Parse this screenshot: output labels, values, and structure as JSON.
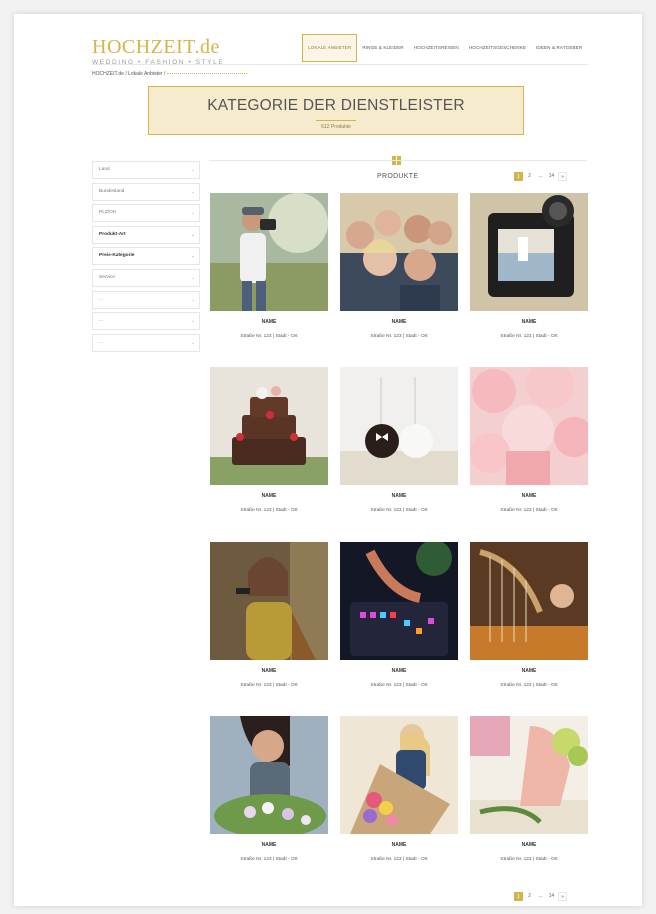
{
  "header": {
    "logo_main": "HOCHZEIT.de",
    "logo_sub": "WEDDING  •  FASHION  •  STYLE",
    "nav": [
      "LOKALE ANBIETER",
      "RINGE & KLEIDER",
      "HOCHZEITSREISEN",
      "HOCHZEITSGESCHENKE",
      "IDEEN & RATGEBER"
    ]
  },
  "breadcrumb": "HOCHZEIT.de / Lokale Anbieter /",
  "hero": {
    "title": "KATEGORIE DER DIENSTLEISTER",
    "count": "612 Produkte"
  },
  "filters": [
    "Land",
    "Bundesland",
    "PLZ/Ort",
    "Produkt-Art",
    "Preis-Kategorie",
    "Service",
    "...",
    "...",
    "..."
  ],
  "products_label": "PRODUKTE",
  "pager": {
    "pages": [
      "1",
      "2",
      "...",
      "14",
      "»"
    ],
    "active": "1"
  },
  "products": [
    {
      "name": "NAME",
      "addr": "Straße Nr. 123 | Stadt - Ort",
      "icon": "photographer-photo"
    },
    {
      "name": "NAME",
      "addr": "Straße Nr. 123 | Stadt - Ort",
      "icon": "group-selfie-photo"
    },
    {
      "name": "NAME",
      "addr": "Straße Nr. 123 | Stadt - Ort",
      "icon": "camera-screen-photo"
    },
    {
      "name": "NAME",
      "addr": "Straße Nr. 123 | Stadt - Ort",
      "icon": "wedding-cake-photo"
    },
    {
      "name": "NAME",
      "addr": "Straße Nr. 123 | Stadt - Ort",
      "icon": "cake-pops-photo"
    },
    {
      "name": "NAME",
      "addr": "Straße Nr. 123 | Stadt - Ort",
      "icon": "cupcakes-photo"
    },
    {
      "name": "NAME",
      "addr": "Straße Nr. 123 | Stadt - Ort",
      "icon": "singer-photo"
    },
    {
      "name": "NAME",
      "addr": "Straße Nr. 123 | Stadt - Ort",
      "icon": "dj-mixer-photo"
    },
    {
      "name": "NAME",
      "addr": "Straße Nr. 123 | Stadt - Ort",
      "icon": "harp-photo"
    },
    {
      "name": "NAME",
      "addr": "Straße Nr. 123 | Stadt - Ort",
      "icon": "florist-photo"
    },
    {
      "name": "NAME",
      "addr": "Straße Nr. 123 | Stadt - Ort",
      "icon": "flower-bouquet-photo"
    },
    {
      "name": "NAME",
      "addr": "Straße Nr. 123 | Stadt - Ort",
      "icon": "flower-shop-photo"
    }
  ],
  "colors": {
    "accent": "#d4b54c",
    "hero_bg": "#f6eccd"
  }
}
